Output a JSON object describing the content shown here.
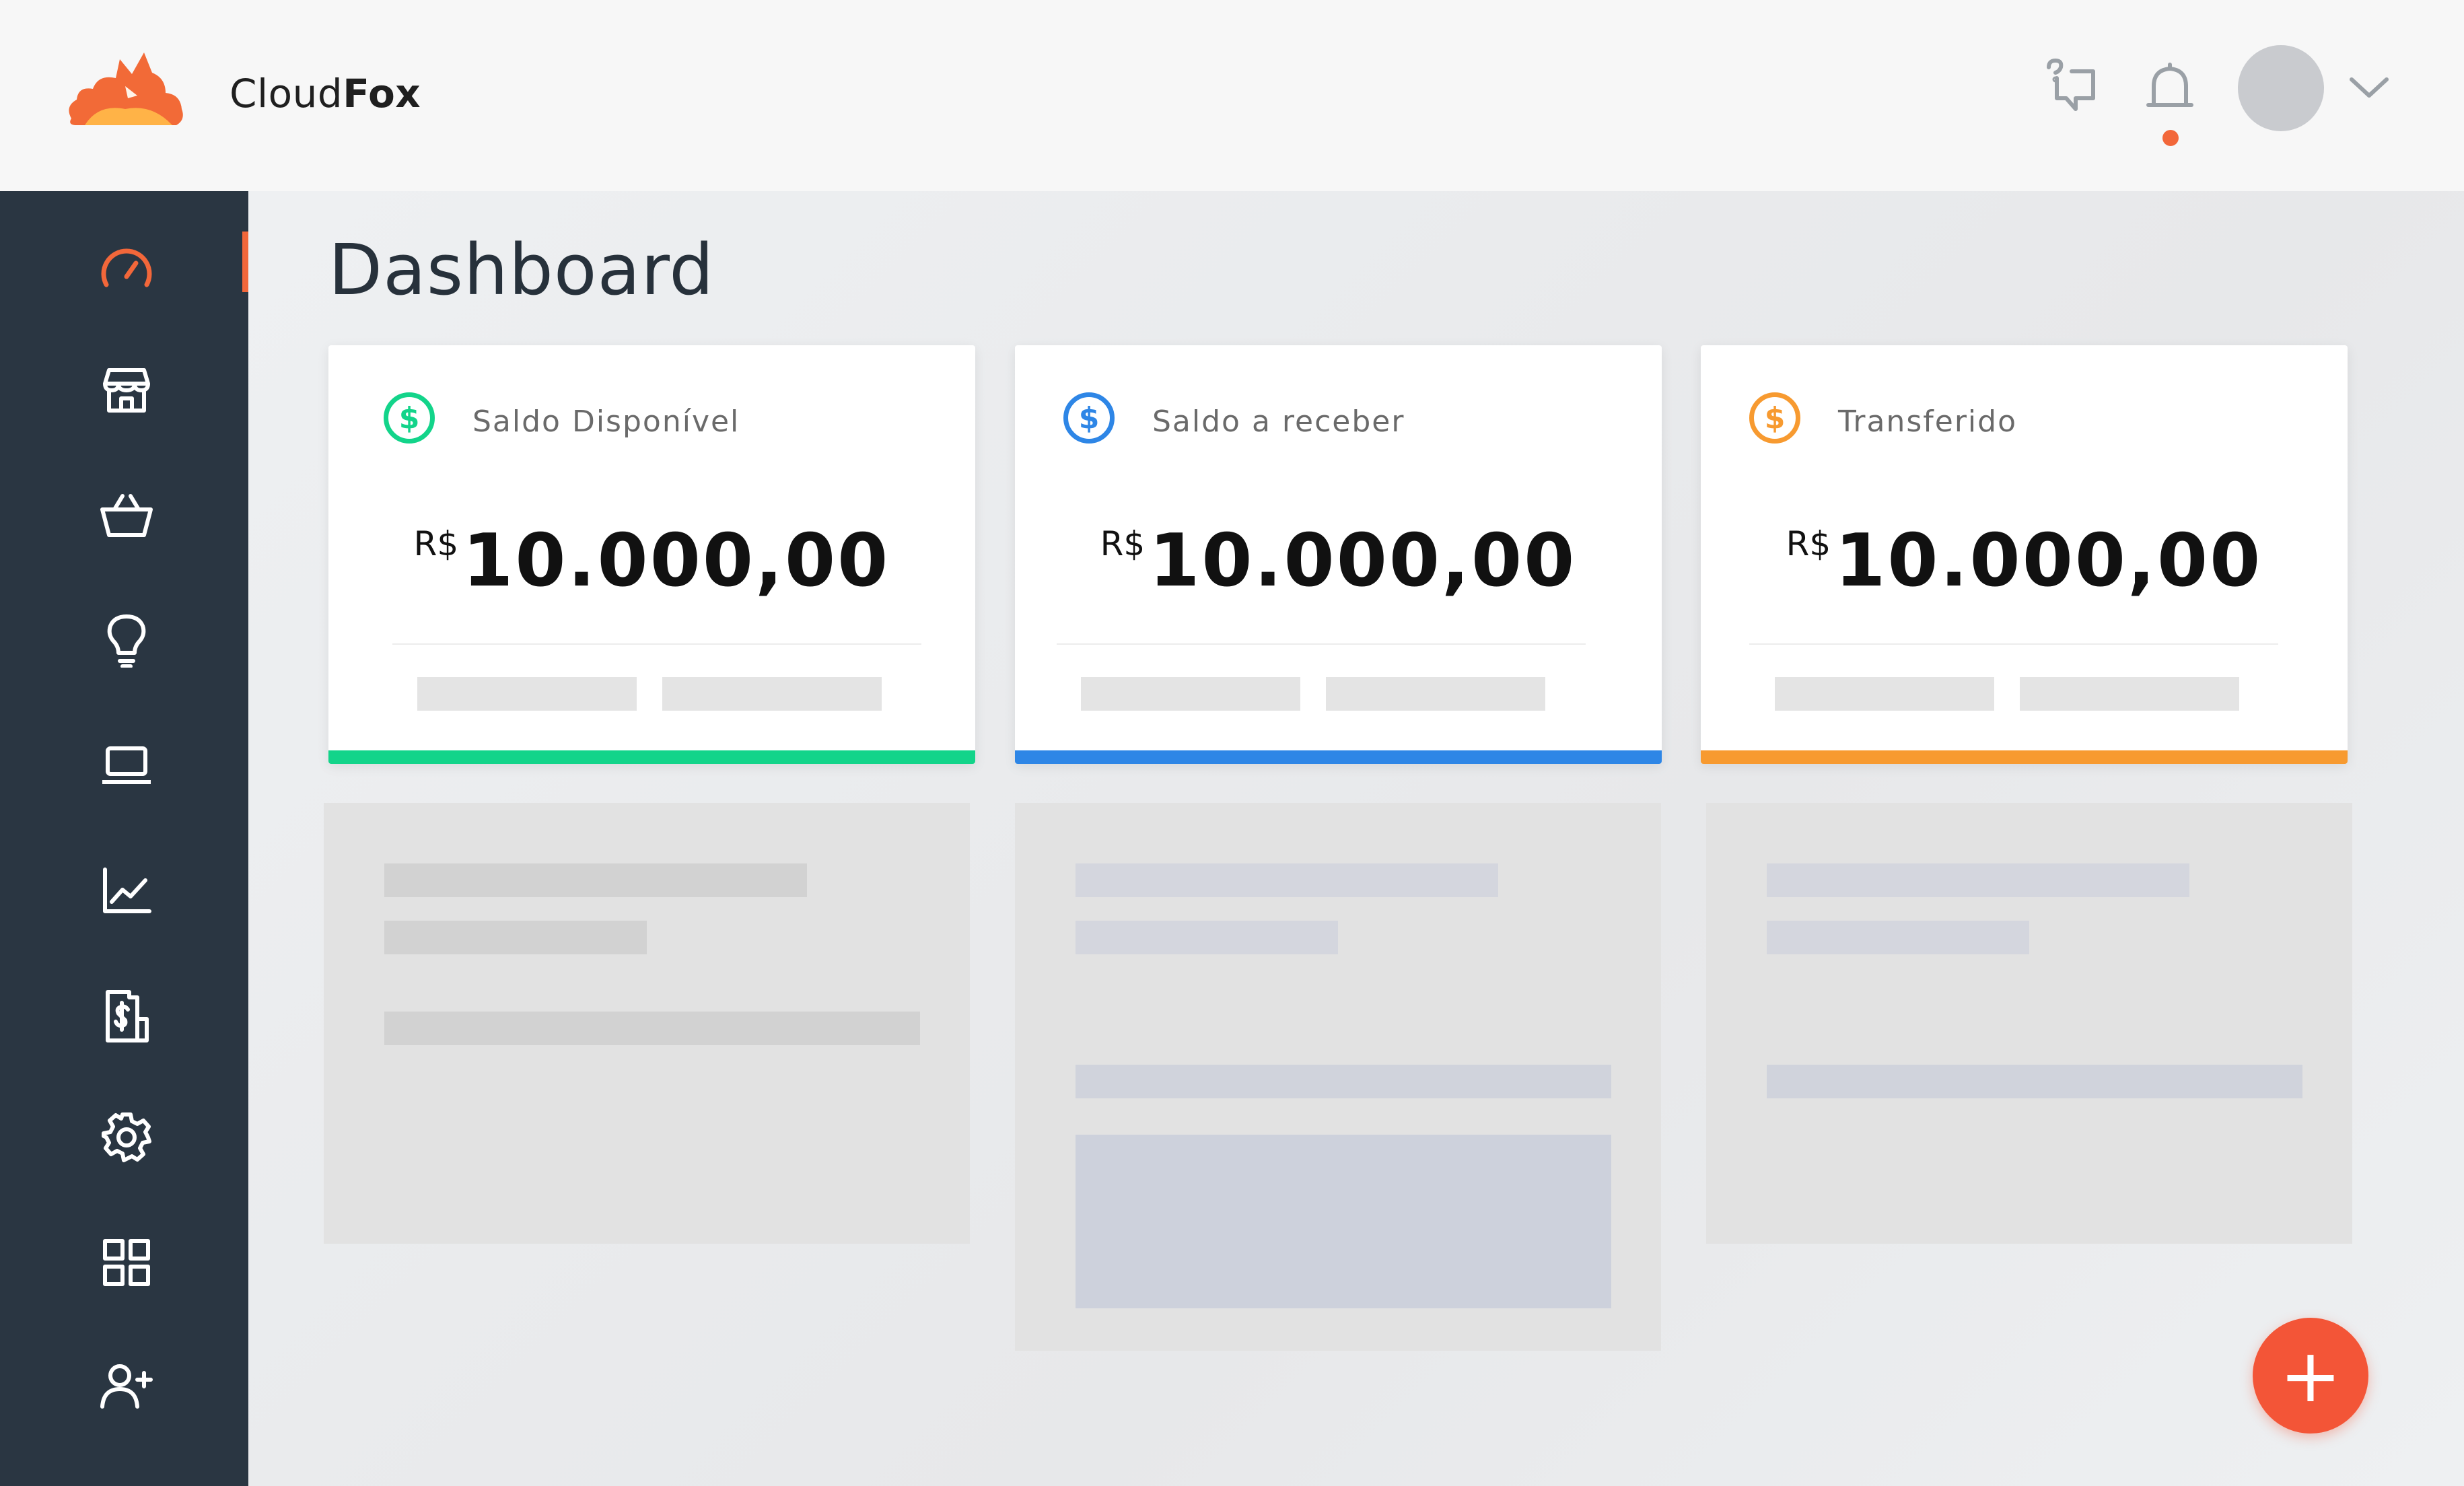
{
  "header": {
    "brand_light": "Cloud",
    "brand_bold": "Fox",
    "icons": [
      "help-chat-icon",
      "bell-icon",
      "chevron-down-icon"
    ]
  },
  "sidebar": {
    "items": [
      {
        "icon": "speedometer-icon",
        "active": true
      },
      {
        "icon": "store-icon"
      },
      {
        "icon": "basket-icon"
      },
      {
        "icon": "lightbulb-icon"
      },
      {
        "icon": "laptop-icon"
      },
      {
        "icon": "chart-line-icon"
      },
      {
        "icon": "receipt-dollar-icon"
      },
      {
        "icon": "gear-icon"
      },
      {
        "icon": "grid-icon"
      },
      {
        "icon": "add-user-icon"
      }
    ]
  },
  "main": {
    "title": "Dashboard",
    "cards": [
      {
        "label": "Saldo Disponível",
        "currency": "R$",
        "amount": "10.000,00",
        "color": "#13d48a",
        "icon": "dollar-circle-icon"
      },
      {
        "label": "Saldo a receber",
        "currency": "R$",
        "amount": "10.000,00",
        "color": "#2e86e6",
        "icon": "dollar-circle-icon"
      },
      {
        "label": "Transferido",
        "currency": "R$",
        "amount": "10.000,00",
        "color": "#f79a30",
        "icon": "dollar-circle-icon"
      }
    ]
  },
  "fab": {
    "symbol": "+",
    "color": "#f35537"
  },
  "colors": {
    "accent": "#f2673a",
    "sidebar": "#2a3642"
  }
}
